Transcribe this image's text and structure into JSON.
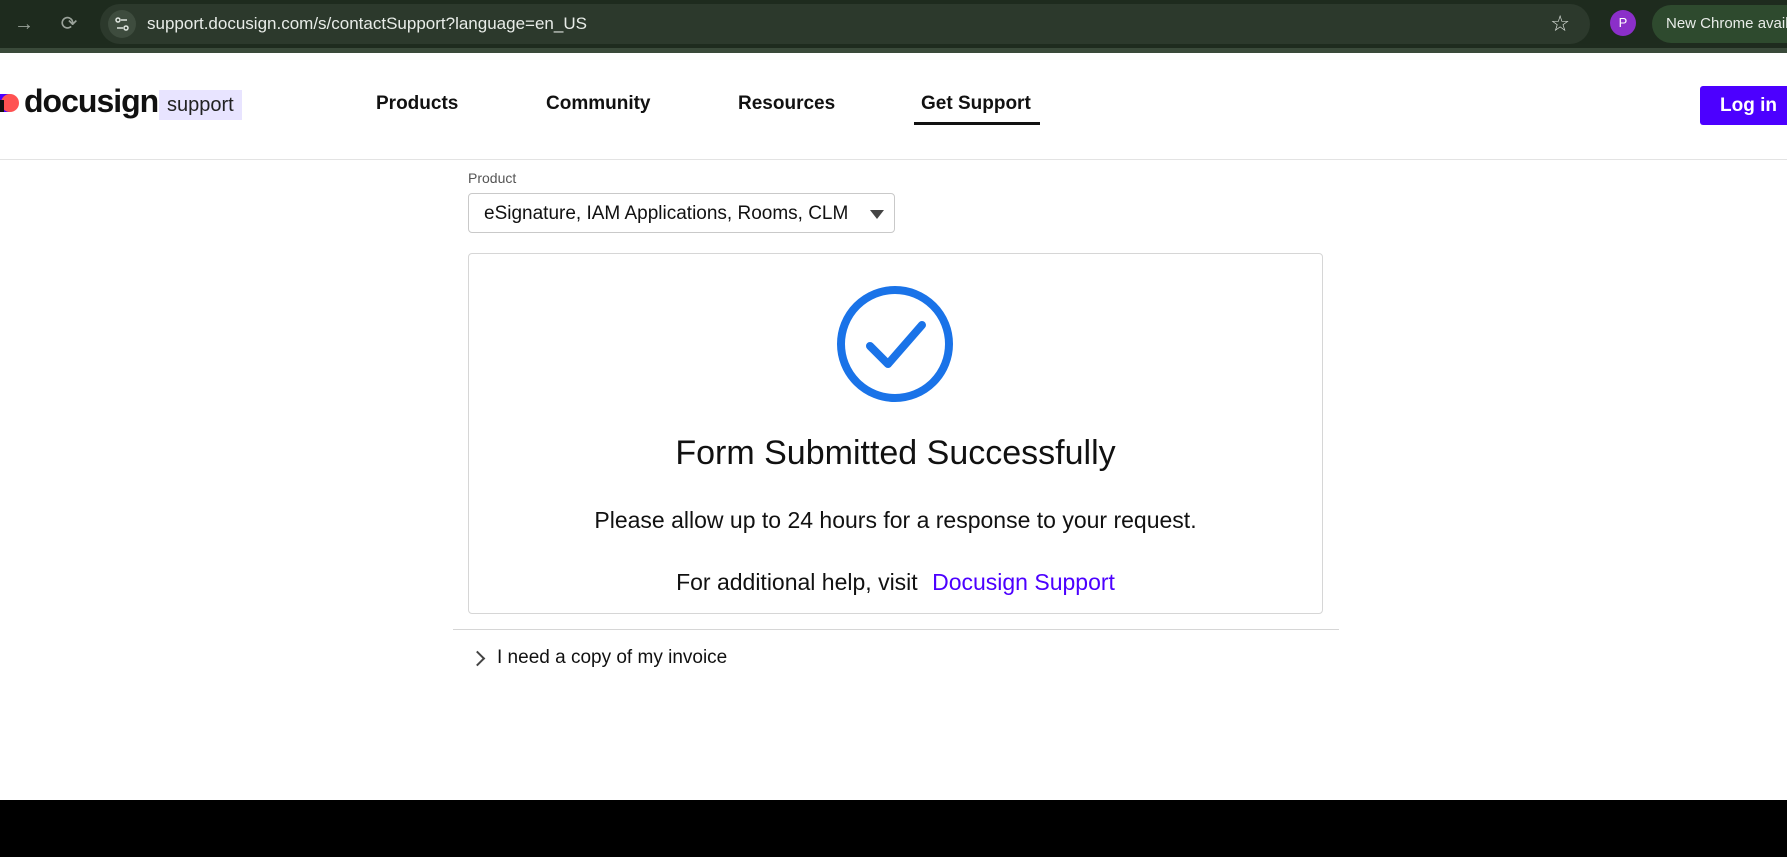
{
  "browser": {
    "url": "support.docusign.com/s/contactSupport?language=en_US",
    "profile_initial": "P",
    "pill_text": "New Chrome available"
  },
  "header": {
    "logo_text": "docusign",
    "logo_tag": "support",
    "nav": {
      "products": "Products",
      "community": "Community",
      "resources": "Resources",
      "get_support": "Get Support"
    },
    "login_label": "Log in"
  },
  "product": {
    "label": "Product",
    "selected": "eSignature, IAM Applications, Rooms, CLM"
  },
  "success": {
    "title": "Form Submitted Successfully",
    "message": "Please allow up to 24 hours for a response to your request.",
    "help_prefix": "For additional help, visit",
    "help_link": "Docusign Support"
  },
  "accordion": {
    "label": "I need a copy of my invoice"
  },
  "colors": {
    "brand": "#4c00ff",
    "check": "#1a73e8"
  },
  "icons": [
    "forward-icon",
    "reload-icon",
    "site-info-icon",
    "star-icon",
    "checkmark-circle-icon",
    "chevron-right-icon",
    "dropdown-caret-icon"
  ]
}
